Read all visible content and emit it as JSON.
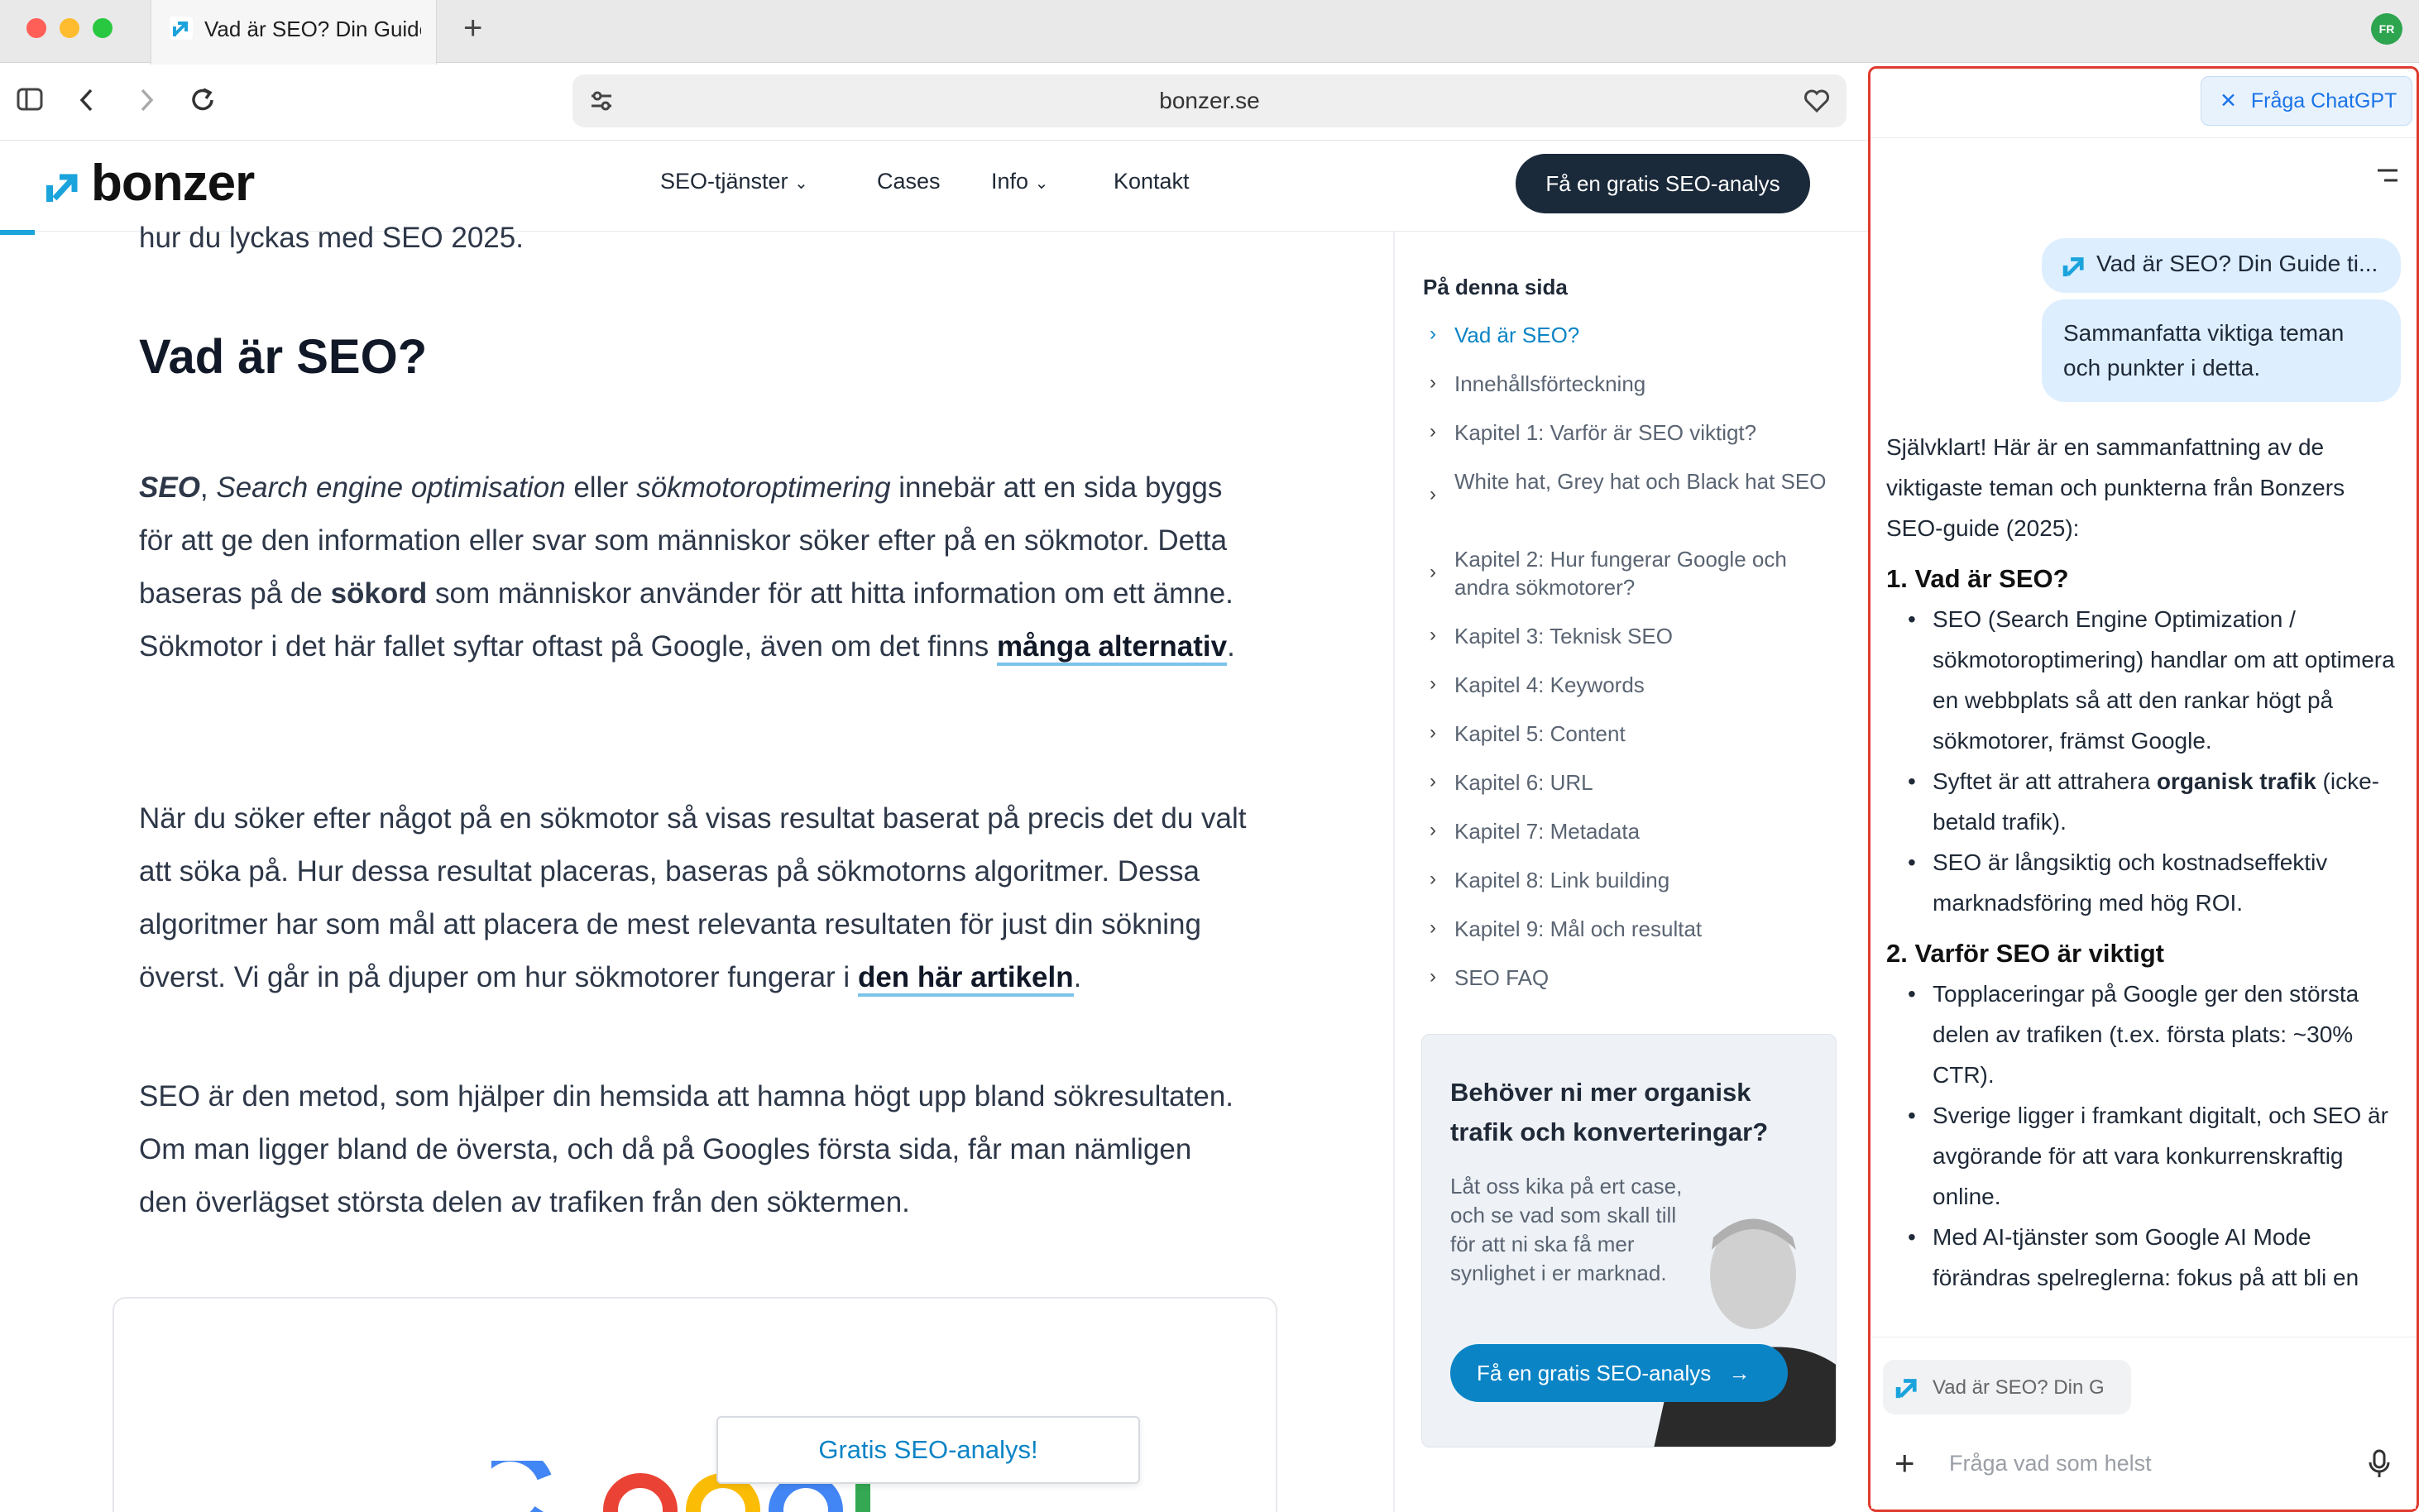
{
  "browser": {
    "tab_title": "Vad är SEO? Din Guide",
    "new_tab": "+",
    "profile": "FR",
    "url": "bonzer.se"
  },
  "site": {
    "logo": "bonzer",
    "nav": [
      "SEO-tjänster",
      "Cases",
      "Info",
      "Kontakt"
    ],
    "cta": "Få en gratis SEO-analys"
  },
  "article": {
    "cut_line": "hur du lyckas med SEO 2025.",
    "heading": "Vad är SEO?",
    "p1_a": "SEO",
    "p1_b": ", ",
    "p1_c": "Search engine optimisation",
    "p1_d": " eller ",
    "p1_e": "sökmotoroptimering",
    "p1_f": " innebär att en sida byggs för att ge den information eller svar som människor söker efter på en sökmotor. Detta baseras på de ",
    "p1_g": "sökord",
    "p1_h": " som människor använder för att hitta information om ett ämne. Sökmotor i det här fallet syftar oftast på Google, även om det finns ",
    "p1_link": "många alternativ",
    "p1_end": ".",
    "p2": "När du söker efter något på en sökmotor så visas resultat baserat på precis det du valt att söka på. Hur dessa resultat placeras, baseras på sökmotorns algoritmer. Dessa algoritmer har som mål att placera de mest relevanta resultaten för just din sökning överst. Vi går in på djuper om hur sökmotorer fungerar i ",
    "p2_link": "den här artikeln",
    "p2_end": ".",
    "p3": "SEO är den metod, som hjälper din hemsida att hamna högt upp bland sökresultaten. Om man ligger bland de översta, och då på Googles första sida, får man nämligen den överlägset största delen av trafiken från den söktermen.",
    "float_button": "Gratis SEO-analys!"
  },
  "toc": {
    "title": "På denna sida",
    "items": [
      "Vad är SEO?",
      "Innehållsförteckning",
      "Kapitel 1: Varför är SEO viktigt?",
      "White hat, Grey hat och Black hat SEO",
      "Kapitel 2: Hur fungerar Google och andra sökmotorer?",
      "Kapitel 3: Teknisk SEO",
      "Kapitel 4: Keywords",
      "Kapitel 5: Content",
      "Kapitel 6: URL",
      "Kapitel 7: Metadata",
      "Kapitel 8: Link building",
      "Kapitel 9: Mål och resultat",
      "SEO FAQ"
    ]
  },
  "promo": {
    "title": "Behöver ni mer organisk trafik och konverteringar?",
    "body": "Låt oss kika på ert case, och se vad som skall till för att ni ska få mer synlighet i er marknad.",
    "button": "Få en gratis SEO-analys"
  },
  "chat": {
    "header_button": "Fråga ChatGPT",
    "user_attachment": "Vad är SEO? Din Guide ti...",
    "user_message": "Sammanfatta viktiga teman och punkter i detta.",
    "intro": "Självklart! Här är en sammanfattning av de viktigaste teman och punkterna från Bonzers SEO-guide (2025):",
    "s1_title": "1. Vad är SEO?",
    "s1_b1": "SEO (Search Engine Optimization / sökmotoroptimering) handlar om att optimera en webbplats så att den rankar högt på sökmotorer, främst Google.",
    "s1_b2_a": "Syftet är att attrahera ",
    "s1_b2_bold": "organisk trafik",
    "s1_b2_c": " (icke-betald trafik).",
    "s1_b3": "SEO är långsiktig och kostnadseffektiv marknadsföring med hög ROI.",
    "s2_title": "2. Varför SEO är viktigt",
    "s2_b1": "Topplaceringar på Google ger den största delen av trafiken (t.ex. första plats: ~30% CTR).",
    "s2_b2": "Sverige ligger i framkant digitalt, och SEO är avgörande för att vara konkurrenskraftig online.",
    "s2_b3": "Med AI-tjänster som Google AI Mode förändras spelreglerna: fokus på att bli en",
    "context_chip": "Vad är SEO? Din G",
    "input_placeholder": "Fråga vad som helst"
  },
  "colors": {
    "accent_blue": "#0b84c6",
    "dark_navy": "#1b2a3a",
    "highlight_red": "#e03a2e"
  }
}
